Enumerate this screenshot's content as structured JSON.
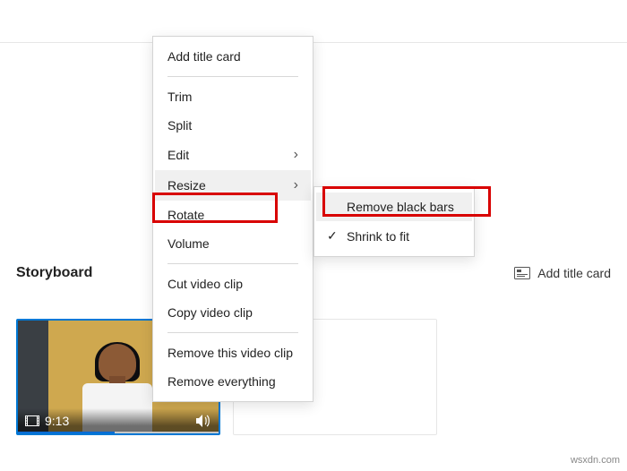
{
  "topbar": {},
  "storyboard": {
    "title": "Storyboard",
    "add_card_label": "Add title card"
  },
  "clip": {
    "duration": "9:13"
  },
  "context_menu": {
    "items": [
      {
        "label": "Add title card",
        "has_sub": false
      },
      {
        "label": "Trim",
        "has_sub": false
      },
      {
        "label": "Split",
        "has_sub": false
      },
      {
        "label": "Edit",
        "has_sub": true
      },
      {
        "label": "Resize",
        "has_sub": true,
        "hovered": true
      },
      {
        "label": "Rotate",
        "has_sub": false
      },
      {
        "label": "Volume",
        "has_sub": false
      },
      {
        "label": "Cut video clip",
        "has_sub": false
      },
      {
        "label": "Copy video clip",
        "has_sub": false
      },
      {
        "label": "Remove this video clip",
        "has_sub": false
      },
      {
        "label": "Remove everything",
        "has_sub": false
      }
    ]
  },
  "submenu": {
    "items": [
      {
        "label": "Remove black bars",
        "checked": false,
        "hovered": true
      },
      {
        "label": "Shrink to fit",
        "checked": true
      }
    ]
  },
  "watermark": "wsxdn.com"
}
